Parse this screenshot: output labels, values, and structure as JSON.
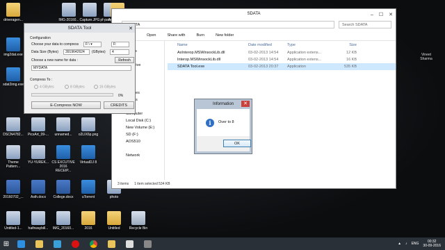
{
  "desktop": {
    "icons": [
      {
        "label": "driveragen...",
        "icon": "folder-icon"
      },
      {
        "label": "IMG-20160...",
        "icon": "image-icon"
      },
      {
        "label": "Capture.JPG",
        "icon": "image-icon"
      },
      {
        "label": "pf-patrykgo...",
        "icon": "image-icon"
      },
      {
        "label": "Advertism...",
        "icon": "folder-icon"
      },
      {
        "label": "img2dat.exe",
        "icon": "app-icon"
      },
      {
        "label": "sdat2img.exe",
        "icon": "app-icon"
      },
      {
        "label": "DSCN4782...",
        "icon": "image-icon"
      },
      {
        "label": "PicsArt_09-...",
        "icon": "image-icon"
      },
      {
        "label": "unnamed...",
        "icon": "image-icon"
      },
      {
        "label": "o2LIX6p.png",
        "icon": "image-icon"
      },
      {
        "label": "Theme Pattern...",
        "icon": "image-icon"
      },
      {
        "label": "YU-YUREK...",
        "icon": "image-icon"
      },
      {
        "label": "CS EXCUTIVE 2016 RECEIP...",
        "icon": "app-icon"
      },
      {
        "label": "VirtualDJ 8",
        "icon": "app-icon"
      },
      {
        "label": "20160702_...",
        "icon": "word-icon"
      },
      {
        "label": "Asth.docx",
        "icon": "word-icon"
      },
      {
        "label": "College.docx",
        "icon": "word-icon"
      },
      {
        "label": "uTorrent",
        "icon": "app-icon"
      },
      {
        "label": "photo",
        "icon": "image-icon"
      },
      {
        "label": "Untitled-1...",
        "icon": "image-icon"
      },
      {
        "label": "hathwaybill...",
        "icon": "image-icon"
      },
      {
        "label": "IMG_20160...",
        "icon": "image-icon"
      },
      {
        "label": "2016",
        "icon": "folder-icon"
      },
      {
        "label": "Untitled",
        "icon": "folder-icon"
      },
      {
        "label": "Recycle Bin",
        "icon": "recycle-bin-icon"
      }
    ],
    "corner_text": "Vineet Sharma"
  },
  "explorer": {
    "title": "SDATA",
    "address": "SDATA",
    "search_placeholder": "Search SDATA",
    "toolbar": [
      "Open",
      "Share with",
      "Burn",
      "New folder"
    ],
    "nav": [
      "op",
      "places",
      "loads",
      "ive Drive",
      "ries",
      "ents",
      "c",
      "Pictures",
      "Videos",
      "",
      "Computer",
      "Local Disk (C:)",
      "New Volume (E:)",
      "SD (F:)",
      "AOS510",
      "",
      "Network"
    ],
    "columns": [
      "Name",
      "Date modified",
      "Type",
      "Size"
    ],
    "files": [
      {
        "name": "AxInterop.MSWinsockLib.dll",
        "date": "03-02-2013 14:54",
        "type": "Application extens...",
        "size": "12 KB",
        "selected": false
      },
      {
        "name": "Interop.MSWinsockLib.dll",
        "date": "03-02-2013 14:54",
        "type": "Application extens...",
        "size": "16 KB",
        "selected": false
      },
      {
        "name": "SDATA Tool.exe",
        "date": "03-02-2013 20:37",
        "type": "Application",
        "size": "535 KB",
        "selected": true
      }
    ],
    "status": {
      "items": "3 items",
      "selected": "1 item selected  534 KB"
    }
  },
  "tool": {
    "title": "SDATA Tool",
    "config_label": "Configuration",
    "drive_label": "Choose your data to compress",
    "drive_value": "F:\\",
    "drive_box": "F:",
    "datasize_label": "Data Size (Bytes)",
    "datasize_value": "3919642624",
    "gbytes_label": "(GBytes)",
    "gbytes_value": "4",
    "name_label": "Choose a new name for data :",
    "refresh": "Refresh",
    "name_value": "MYDATA",
    "compress_to": "Compress To :",
    "options": [
      "4 GBytes",
      "8 GBytes",
      "16 GBytes"
    ],
    "progress_percent": 0,
    "progress_label": "0%",
    "ecompress": "E-Compress NOW",
    "credits": "CREDITS"
  },
  "dialog": {
    "title": "Information",
    "message": "Over to 8",
    "ok": "OK"
  },
  "taskbar": {
    "time": "00:32",
    "date": "30-09-2016",
    "lang": "ENG"
  }
}
